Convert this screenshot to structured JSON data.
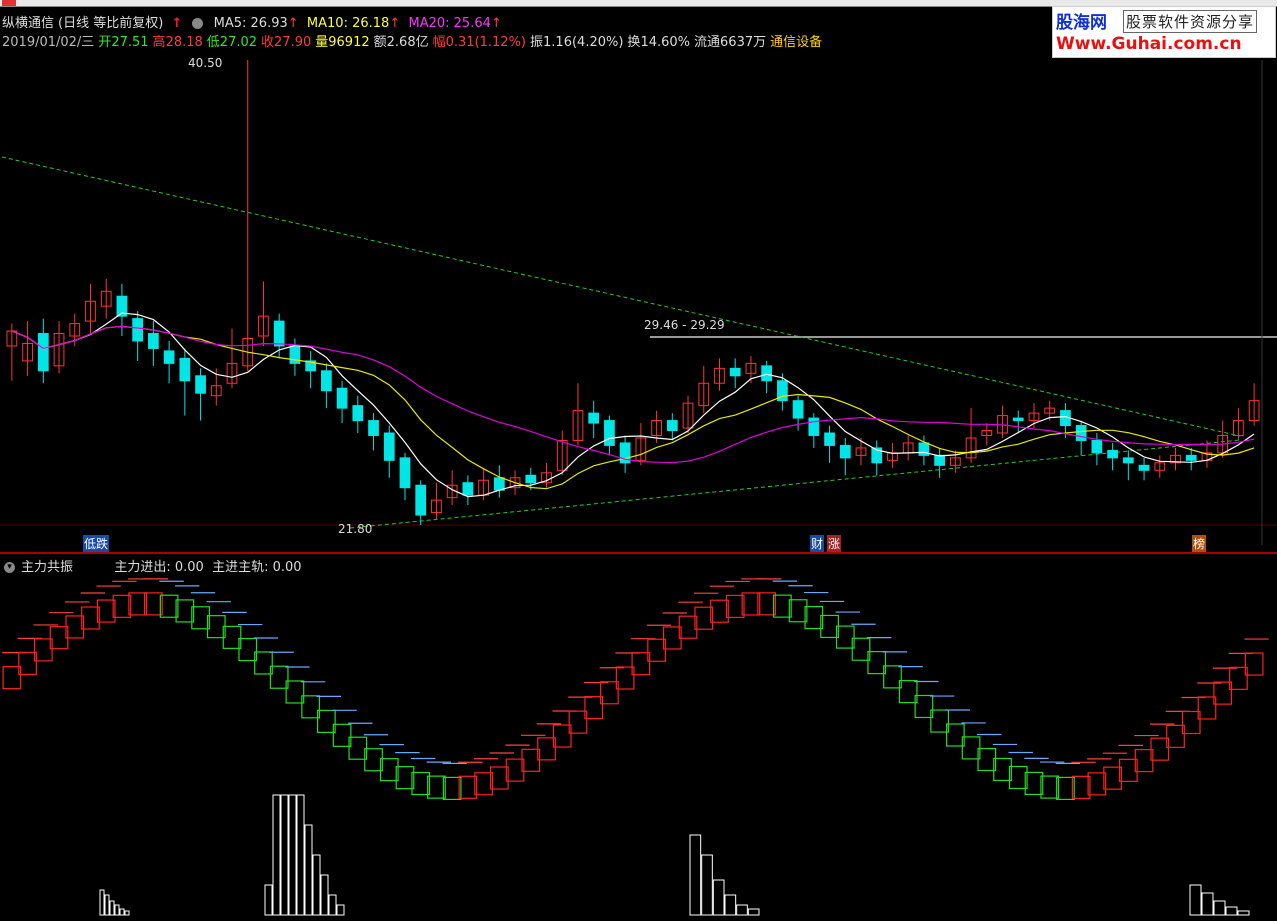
{
  "stock": {
    "name": "纵横通信",
    "mode": "(日线 等比前复权)",
    "ma5_label": "MA5:",
    "ma5_value": "26.93",
    "ma10_label": "MA10:",
    "ma10_value": "26.18",
    "ma20_label": "MA20:",
    "ma20_value": "25.64"
  },
  "quote": {
    "date": "2019/01/02/三",
    "open_label": "开",
    "open": "27.51",
    "high_label": "高",
    "high": "28.18",
    "low_label": "低",
    "low": "27.02",
    "close_label": "收",
    "close": "27.90",
    "volume_label": "量",
    "volume": "96912",
    "amount_label": "额",
    "amount": "2.68亿",
    "change_label": "幅",
    "change": "0.31",
    "change_pct": "(1.12%)",
    "amplitude_label": "振",
    "amplitude": "1.16(4.20%)",
    "turnover_label": "换",
    "turnover": "14.60%",
    "float_label": "流通",
    "float_shares": "6637万",
    "sector": "通信设备"
  },
  "logo": {
    "line1": "股海网",
    "line1b": "股票软件资源分享",
    "line2": "Www.Guhai.com.cn"
  },
  "annotations": {
    "high_price": "40.50",
    "low_price": "21.80",
    "range_label": "29.46 - 29.29",
    "tag_left": "低跌",
    "tag_mid_a": "财",
    "tag_mid_b": "涨",
    "tag_right": "榜"
  },
  "indicator": {
    "name": "主力共振",
    "line1_label": "主力进出:",
    "line1_value": "0.00",
    "line2_label": "主进主轨:",
    "line2_value": "0.00"
  },
  "colors": {
    "up": "#ff3333",
    "down": "#00e5e5",
    "ma5": "#ffffff",
    "ma10": "#e8e800",
    "ma20": "#e000e0",
    "trend": "#22cc22",
    "box_up": "#ff2020",
    "box_down": "#22dd22"
  },
  "chart_data": {
    "type": "candlestick",
    "y_price_range": [
      21.8,
      40.5
    ],
    "candles": [
      [
        29.0,
        29.6,
        29.9,
        27.6
      ],
      [
        28.4,
        29.1,
        30.0,
        27.8
      ],
      [
        29.5,
        28.0,
        30.1,
        27.5
      ],
      [
        28.2,
        29.5,
        30.0,
        27.9
      ],
      [
        29.4,
        29.9,
        30.3,
        29.0
      ],
      [
        30.0,
        30.8,
        31.5,
        29.5
      ],
      [
        30.6,
        31.2,
        31.7,
        30.1
      ],
      [
        31.0,
        30.2,
        31.5,
        29.4
      ],
      [
        30.1,
        29.2,
        30.4,
        28.4
      ],
      [
        29.5,
        28.9,
        30.0,
        28.2
      ],
      [
        28.8,
        28.3,
        29.2,
        27.5
      ],
      [
        28.5,
        27.6,
        28.9,
        26.2
      ],
      [
        27.8,
        27.1,
        28.1,
        26.0
      ],
      [
        27.0,
        27.4,
        28.1,
        26.6
      ],
      [
        27.5,
        28.3,
        29.7,
        27.3
      ],
      [
        28.2,
        29.3,
        40.5,
        28.0
      ],
      [
        29.4,
        30.2,
        31.6,
        29.0
      ],
      [
        30.0,
        29.0,
        30.3,
        28.5
      ],
      [
        29.0,
        28.3,
        29.3,
        27.8
      ],
      [
        28.4,
        28.0,
        28.8,
        27.3
      ],
      [
        28.0,
        27.2,
        28.3,
        26.5
      ],
      [
        27.3,
        26.5,
        27.6,
        25.9
      ],
      [
        26.6,
        26.0,
        27.0,
        25.5
      ],
      [
        26.0,
        25.4,
        26.3,
        24.8
      ],
      [
        25.5,
        24.4,
        25.8,
        23.7
      ],
      [
        24.5,
        23.3,
        24.7,
        22.8
      ],
      [
        23.4,
        22.2,
        23.6,
        21.8
      ],
      [
        22.3,
        22.8,
        23.5,
        22.0
      ],
      [
        22.9,
        23.4,
        24.0,
        22.6
      ],
      [
        23.5,
        23.0,
        23.8,
        22.6
      ],
      [
        23.0,
        23.6,
        24.1,
        22.8
      ],
      [
        23.7,
        23.2,
        24.2,
        22.9
      ],
      [
        23.3,
        23.7,
        24.0,
        23.0
      ],
      [
        23.8,
        23.5,
        24.1,
        23.2
      ],
      [
        23.5,
        23.9,
        24.3,
        23.3
      ],
      [
        24.0,
        25.2,
        25.6,
        23.8
      ],
      [
        25.2,
        26.4,
        27.5,
        25.0
      ],
      [
        26.3,
        25.9,
        26.8,
        25.3
      ],
      [
        26.0,
        25.0,
        26.2,
        24.6
      ],
      [
        25.1,
        24.3,
        25.4,
        23.9
      ],
      [
        24.4,
        25.3,
        25.9,
        24.2
      ],
      [
        25.4,
        26.0,
        26.4,
        25.1
      ],
      [
        26.0,
        25.6,
        26.3,
        25.2
      ],
      [
        25.7,
        26.7,
        27.0,
        25.5
      ],
      [
        26.6,
        27.5,
        28.2,
        26.3
      ],
      [
        27.5,
        28.1,
        28.5,
        27.2
      ],
      [
        28.1,
        27.8,
        28.5,
        27.3
      ],
      [
        27.9,
        28.3,
        28.6,
        27.5
      ],
      [
        28.2,
        27.6,
        28.4,
        27.1
      ],
      [
        27.6,
        26.8,
        27.9,
        26.4
      ],
      [
        26.8,
        26.1,
        27.0,
        25.6
      ],
      [
        26.1,
        25.4,
        26.3,
        24.9
      ],
      [
        25.5,
        25.0,
        25.8,
        24.3
      ],
      [
        25.0,
        24.5,
        25.3,
        23.8
      ],
      [
        24.6,
        24.9,
        25.3,
        24.2
      ],
      [
        24.9,
        24.3,
        25.2,
        23.8
      ],
      [
        24.4,
        24.7,
        25.1,
        24.1
      ],
      [
        24.7,
        25.1,
        25.4,
        24.4
      ],
      [
        25.1,
        24.6,
        25.4,
        24.2
      ],
      [
        24.6,
        24.2,
        24.9,
        23.7
      ],
      [
        24.2,
        24.5,
        24.8,
        23.9
      ],
      [
        24.5,
        25.3,
        26.5,
        24.3
      ],
      [
        25.4,
        25.6,
        25.9,
        25.0
      ],
      [
        25.5,
        26.2,
        26.6,
        25.3
      ],
      [
        26.1,
        26.0,
        26.4,
        25.5
      ],
      [
        26.0,
        26.3,
        26.7,
        25.7
      ],
      [
        26.3,
        26.5,
        26.8,
        26.0
      ],
      [
        26.4,
        25.8,
        26.7,
        25.3
      ],
      [
        25.8,
        25.2,
        26.0,
        24.6
      ],
      [
        25.2,
        24.7,
        25.5,
        24.2
      ],
      [
        24.8,
        24.5,
        25.1,
        24.0
      ],
      [
        24.5,
        24.3,
        24.8,
        23.6
      ],
      [
        24.2,
        24.0,
        24.5,
        23.6
      ],
      [
        24.0,
        24.3,
        24.6,
        23.7
      ],
      [
        24.3,
        24.6,
        24.9,
        24.0
      ],
      [
        24.6,
        24.4,
        24.9,
        24.0
      ],
      [
        24.4,
        24.7,
        25.2,
        24.1
      ],
      [
        24.7,
        25.4,
        26.0,
        24.5
      ],
      [
        25.4,
        26.0,
        26.5,
        25.2
      ],
      [
        26.0,
        26.8,
        27.5,
        25.8
      ]
    ]
  }
}
